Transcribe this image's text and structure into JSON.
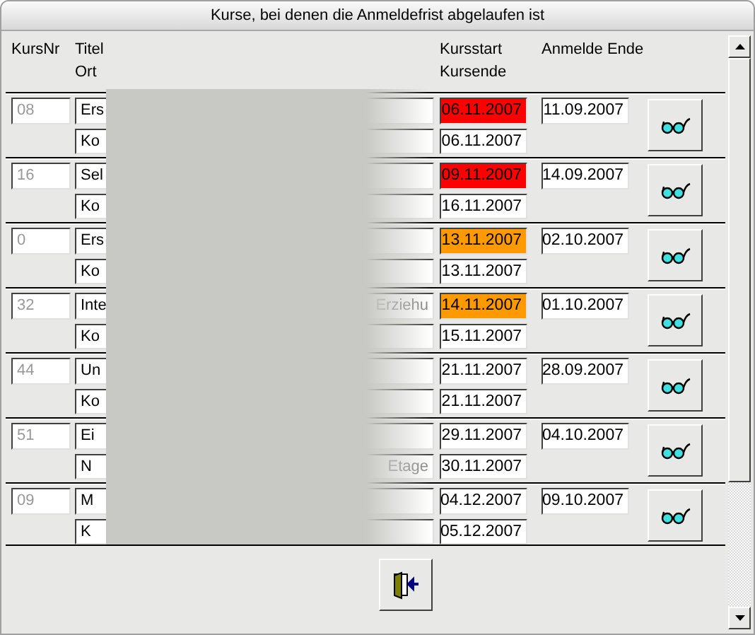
{
  "window": {
    "title": "Kurse, bei denen die Anmeldefrist abgelaufen ist"
  },
  "headers": {
    "kursnr": "KursNr",
    "titel": "Titel",
    "ort": "Ort",
    "kursstart": "Kursstart",
    "kursende": "Kursende",
    "anmelde_ende": "Anmelde Ende"
  },
  "rows": [
    {
      "kursnr": "08",
      "titel": "Ers",
      "ort": "Ko",
      "kursstart": "06.11.2007",
      "start_overdue": true,
      "start_warning": false,
      "kursende": "06.11.2007",
      "anmelde_ende": "11.09.2007"
    },
    {
      "kursnr": "16",
      "titel": "Sel",
      "ort": "Ko",
      "kursstart": "09.11.2007",
      "start_overdue": true,
      "start_warning": false,
      "kursende": "16.11.2007",
      "anmelde_ende": "14.09.2007"
    },
    {
      "kursnr": "0",
      "titel": "Ers",
      "ort": "Ko",
      "kursstart": "13.11.2007",
      "start_overdue": false,
      "start_warning": true,
      "kursende": "13.11.2007",
      "anmelde_ende": "02.10.2007"
    },
    {
      "kursnr": "32",
      "titel": "Inte",
      "titel_tail": "Erziehu",
      "ort": "Ko",
      "kursstart": "14.11.2007",
      "start_overdue": false,
      "start_warning": true,
      "kursende": "15.11.2007",
      "anmelde_ende": "01.10.2007"
    },
    {
      "kursnr": "44",
      "titel": "Un",
      "ort": "Ko",
      "kursstart": "21.11.2007",
      "start_overdue": false,
      "start_warning": false,
      "kursende": "21.11.2007",
      "anmelde_ende": "28.09.2007"
    },
    {
      "kursnr": "51",
      "titel": "Ei",
      "ort": "N",
      "ort_tail": "Etage",
      "kursstart": "29.11.2007",
      "start_overdue": false,
      "start_warning": false,
      "kursende": "30.11.2007",
      "anmelde_ende": "04.10.2007"
    },
    {
      "kursnr": "09",
      "titel": "M",
      "ort": "K",
      "kursstart": "04.12.2007",
      "start_overdue": false,
      "start_warning": false,
      "kursende": "05.12.2007",
      "anmelde_ende": "09.10.2007"
    }
  ]
}
